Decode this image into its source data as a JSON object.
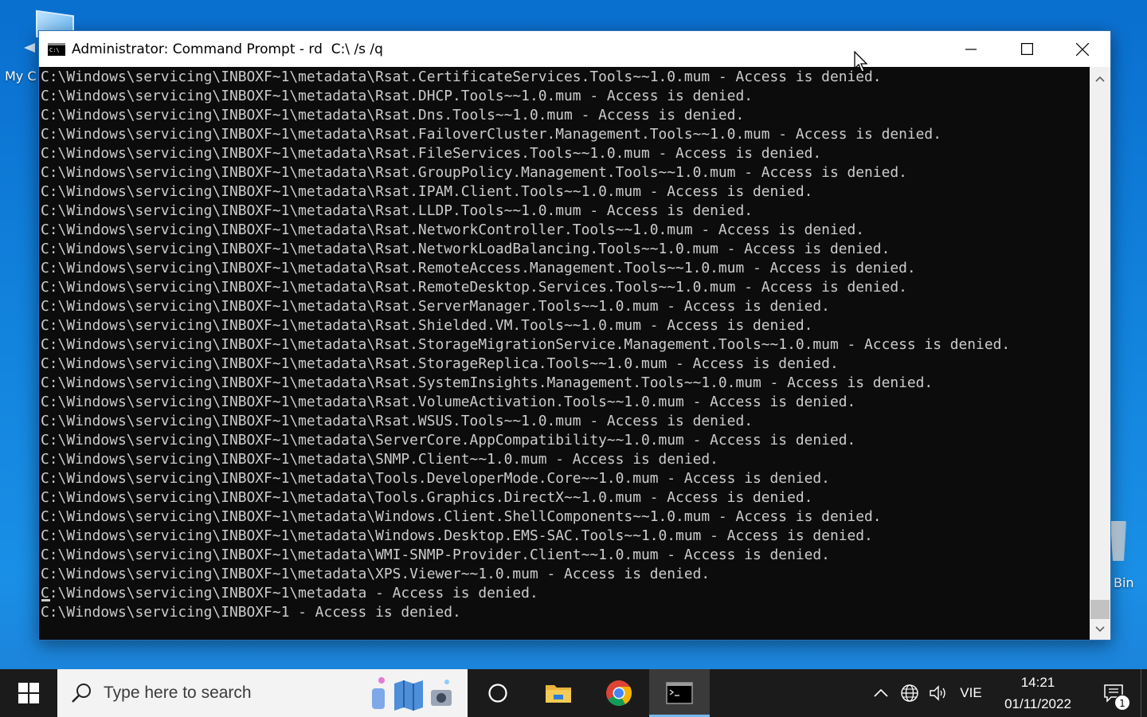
{
  "desktop": {
    "icons": [
      {
        "label": "My C",
        "icon": "this-pc-icon"
      },
      {
        "label": "Bin",
        "icon": "recycle-bin-icon"
      }
    ]
  },
  "window": {
    "title": "Administrator: Command Prompt - rd  C:\\ /s /q",
    "controls": {
      "minimize": "minimize-icon",
      "maximize": "maximize-icon",
      "close": "close-icon"
    },
    "console_lines": [
      "C:\\Windows\\servicing\\INBOXF~1\\metadata\\Rsat.CertificateServices.Tools~~1.0.mum - Access is denied.",
      "C:\\Windows\\servicing\\INBOXF~1\\metadata\\Rsat.DHCP.Tools~~1.0.mum - Access is denied.",
      "C:\\Windows\\servicing\\INBOXF~1\\metadata\\Rsat.Dns.Tools~~1.0.mum - Access is denied.",
      "C:\\Windows\\servicing\\INBOXF~1\\metadata\\Rsat.FailoverCluster.Management.Tools~~1.0.mum - Access is denied.",
      "C:\\Windows\\servicing\\INBOXF~1\\metadata\\Rsat.FileServices.Tools~~1.0.mum - Access is denied.",
      "C:\\Windows\\servicing\\INBOXF~1\\metadata\\Rsat.GroupPolicy.Management.Tools~~1.0.mum - Access is denied.",
      "C:\\Windows\\servicing\\INBOXF~1\\metadata\\Rsat.IPAM.Client.Tools~~1.0.mum - Access is denied.",
      "C:\\Windows\\servicing\\INBOXF~1\\metadata\\Rsat.LLDP.Tools~~1.0.mum - Access is denied.",
      "C:\\Windows\\servicing\\INBOXF~1\\metadata\\Rsat.NetworkController.Tools~~1.0.mum - Access is denied.",
      "C:\\Windows\\servicing\\INBOXF~1\\metadata\\Rsat.NetworkLoadBalancing.Tools~~1.0.mum - Access is denied.",
      "C:\\Windows\\servicing\\INBOXF~1\\metadata\\Rsat.RemoteAccess.Management.Tools~~1.0.mum - Access is denied.",
      "C:\\Windows\\servicing\\INBOXF~1\\metadata\\Rsat.RemoteDesktop.Services.Tools~~1.0.mum - Access is denied.",
      "C:\\Windows\\servicing\\INBOXF~1\\metadata\\Rsat.ServerManager.Tools~~1.0.mum - Access is denied.",
      "C:\\Windows\\servicing\\INBOXF~1\\metadata\\Rsat.Shielded.VM.Tools~~1.0.mum - Access is denied.",
      "C:\\Windows\\servicing\\INBOXF~1\\metadata\\Rsat.StorageMigrationService.Management.Tools~~1.0.mum - Access is denied.",
      "C:\\Windows\\servicing\\INBOXF~1\\metadata\\Rsat.StorageReplica.Tools~~1.0.mum - Access is denied.",
      "C:\\Windows\\servicing\\INBOXF~1\\metadata\\Rsat.SystemInsights.Management.Tools~~1.0.mum - Access is denied.",
      "C:\\Windows\\servicing\\INBOXF~1\\metadata\\Rsat.VolumeActivation.Tools~~1.0.mum - Access is denied.",
      "C:\\Windows\\servicing\\INBOXF~1\\metadata\\Rsat.WSUS.Tools~~1.0.mum - Access is denied.",
      "C:\\Windows\\servicing\\INBOXF~1\\metadata\\ServerCore.AppCompatibility~~1.0.mum - Access is denied.",
      "C:\\Windows\\servicing\\INBOXF~1\\metadata\\SNMP.Client~~1.0.mum - Access is denied.",
      "C:\\Windows\\servicing\\INBOXF~1\\metadata\\Tools.DeveloperMode.Core~~1.0.mum - Access is denied.",
      "C:\\Windows\\servicing\\INBOXF~1\\metadata\\Tools.Graphics.DirectX~~1.0.mum - Access is denied.",
      "C:\\Windows\\servicing\\INBOXF~1\\metadata\\Windows.Client.ShellComponents~~1.0.mum - Access is denied.",
      "C:\\Windows\\servicing\\INBOXF~1\\metadata\\Windows.Desktop.EMS-SAC.Tools~~1.0.mum - Access is denied.",
      "C:\\Windows\\servicing\\INBOXF~1\\metadata\\WMI-SNMP-Provider.Client~~1.0.mum - Access is denied.",
      "C:\\Windows\\servicing\\INBOXF~1\\metadata\\XPS.Viewer~~1.0.mum - Access is denied.",
      "C:\\Windows\\servicing\\INBOXF~1\\metadata - Access is denied.",
      "C:\\Windows\\servicing\\INBOXF~1 - Access is denied."
    ],
    "colors": {
      "console_bg": "#0c0c0c",
      "console_text": "#cccccc",
      "titlebar_bg": "#ffffff"
    }
  },
  "taskbar": {
    "start_icon": "windows-logo-icon",
    "search": {
      "placeholder": "Type here to search",
      "icon": "search-icon"
    },
    "pinned": [
      {
        "name": "task-view",
        "icon": "task-view-icon"
      },
      {
        "name": "file-explorer",
        "icon": "folder-icon"
      },
      {
        "name": "chrome",
        "icon": "chrome-icon"
      },
      {
        "name": "command-prompt",
        "icon": "terminal-icon",
        "active": true
      }
    ],
    "tray": {
      "icons": [
        "chevron-up-icon",
        "network-globe-icon",
        "volume-icon"
      ],
      "language": "VIE",
      "time": "14:21",
      "date": "01/11/2022",
      "notification_count": "1"
    },
    "colors": {
      "taskbar_bg": "#1b1b1b",
      "active_underline": "#76b9ed"
    }
  }
}
